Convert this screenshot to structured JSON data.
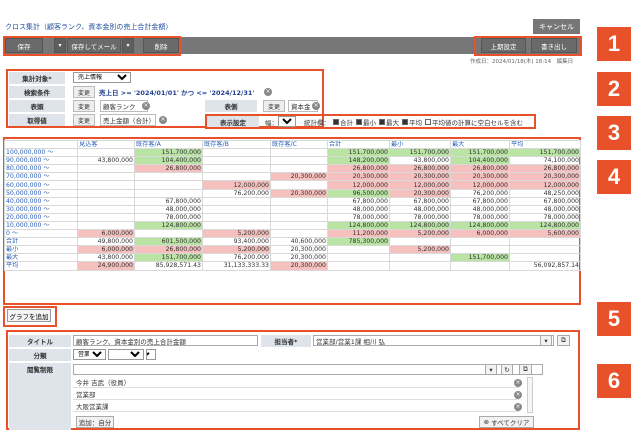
{
  "page_title": "クロス集計（顧客ランク、資本金別の売上合計金額）",
  "cancel_label": "キャンセル",
  "toolbar": {
    "save": "保存",
    "save_mail": "保存してメール",
    "delete": "削除",
    "axis_setting": "上期設定",
    "export": "書き出し"
  },
  "info_text": "作成日：2024/01/18(木) 18:14　編集日",
  "markers": [
    "1",
    "2",
    "3",
    "4",
    "5",
    "6"
  ],
  "conditions": {
    "target_label": "集計対象*",
    "target_value": "売上情報",
    "search_label": "検索条件",
    "change": "変更",
    "search_value": "売上日 >= '2024/01/01' かつ <= '2024/12/31'",
    "rows_label": "表頭",
    "rows_value": "顧客ランク",
    "cols_label": "表側",
    "cols_value": "資本金",
    "measure_label": "取得値",
    "measure_value": "売上金額（合計）",
    "display_label": "表示設定",
    "width_label": "幅：",
    "width_value": "小",
    "stats_label": "統計欄：",
    "stat_sum": "合計",
    "stat_min": "最小",
    "stat_max": "最大",
    "stat_avg": "平均",
    "blank_label": "平均値の計算に空白セルを含む"
  },
  "table": {
    "headers": [
      "",
      "見込客",
      "既存客/A",
      "既存客/B",
      "既存客/C",
      "合計",
      "最小",
      "最大",
      "平均"
    ],
    "rows": [
      [
        "100,000,000 ～",
        "",
        "151,700,000",
        "",
        "",
        "151,700,000",
        "151,700,000",
        "151,700,000",
        "151,700,000"
      ],
      [
        "90,000,000 ～",
        "43,800,000",
        "104,400,000",
        "",
        "",
        "148,200,000",
        "43,800,000",
        "104,400,000",
        "74,100,000"
      ],
      [
        "80,000,000 ～",
        "",
        "26,800,000",
        "",
        "",
        "26,800,000",
        "26,800,000",
        "26,800,000",
        "26,800,000"
      ],
      [
        "70,000,000 ～",
        "",
        "",
        "",
        "20,300,000",
        "20,300,000",
        "20,300,000",
        "20,300,000",
        "20,300,000"
      ],
      [
        "60,000,000 ～",
        "",
        "",
        "12,000,000",
        "",
        "12,000,000",
        "12,000,000",
        "12,000,000",
        "12,000,000"
      ],
      [
        "50,000,000 ～",
        "",
        "",
        "76,200,000",
        "20,300,000",
        "96,500,000",
        "20,300,000",
        "76,200,000",
        "48,250,000"
      ],
      [
        "40,000,000 ～",
        "",
        "67,800,000",
        "",
        "",
        "67,800,000",
        "67,800,000",
        "67,800,000",
        "67,800,000"
      ],
      [
        "30,000,000 ～",
        "",
        "48,000,000",
        "",
        "",
        "48,000,000",
        "48,000,000",
        "48,000,000",
        "48,000,000"
      ],
      [
        "20,000,000 ～",
        "",
        "78,000,000",
        "",
        "",
        "78,000,000",
        "78,000,000",
        "78,000,000",
        "78,000,000"
      ],
      [
        "10,000,000 ～",
        "",
        "124,800,000",
        "",
        "",
        "124,800,000",
        "124,800,000",
        "124,800,000",
        "124,800,000"
      ],
      [
        "0 ～",
        "6,000,000",
        "",
        "5,200,000",
        "",
        "11,200,000",
        "5,200,000",
        "6,000,000",
        "5,600,000"
      ],
      [
        "合計",
        "49,800,000",
        "601,500,000",
        "93,400,000",
        "40,600,000",
        "785,300,000",
        "",
        "",
        ""
      ],
      [
        "最小",
        "6,000,000",
        "26,800,000",
        "5,200,000",
        "20,300,000",
        "",
        "5,200,000",
        "",
        ""
      ],
      [
        "最大",
        "43,800,000",
        "151,700,000",
        "76,200,000",
        "20,300,000",
        "",
        "",
        "151,700,000",
        ""
      ],
      [
        "平均",
        "24,900,000",
        "85,928,571.43",
        "31,133,333.33",
        "20,300,000",
        "",
        "",
        "",
        "56,092,857.14"
      ]
    ],
    "highlights": [
      [
        "",
        "",
        "g",
        "",
        "",
        "g",
        "g",
        "g",
        "g"
      ],
      [
        "",
        "",
        "g",
        "",
        "",
        "g",
        "",
        "g",
        ""
      ],
      [
        "",
        "",
        "r",
        "",
        "",
        "r",
        "r",
        "r",
        "r"
      ],
      [
        "",
        "",
        "",
        "",
        "r",
        "r",
        "r",
        "r",
        "r"
      ],
      [
        "",
        "",
        "",
        "r",
        "",
        "r",
        "r",
        "r",
        "r"
      ],
      [
        "",
        "",
        "",
        "",
        "r",
        "g",
        "r",
        "",
        ""
      ],
      [
        "",
        "",
        "",
        "",
        "",
        "",
        "",
        "",
        ""
      ],
      [
        "",
        "",
        "",
        "",
        "",
        "",
        "",
        "",
        ""
      ],
      [
        "",
        "",
        "",
        "",
        "",
        "",
        "",
        "",
        ""
      ],
      [
        "",
        "",
        "g",
        "",
        "",
        "g",
        "g",
        "g",
        "g"
      ],
      [
        "",
        "r",
        "",
        "r",
        "",
        "r",
        "r",
        "r",
        "r"
      ],
      [
        "",
        "",
        "g",
        "",
        "",
        "g",
        "",
        "",
        ""
      ],
      [
        "",
        "r",
        "r",
        "r",
        "",
        "",
        "r",
        "",
        ""
      ],
      [
        "",
        "",
        "g",
        "",
        "",
        "",
        "",
        "g",
        ""
      ],
      [
        "",
        "r",
        "",
        "",
        "r",
        "",
        "",
        "",
        ""
      ]
    ]
  },
  "graph_button": "グラフを追加",
  "form": {
    "title_label": "タイトル",
    "title_value": "顧客ランク、資本金別の売上合計金額",
    "owner_label": "担当者*",
    "owner_value": "営業部/営業1課 相川 弘",
    "category_label": "分類",
    "category_value": "営業部",
    "browse_label": "閲覧制限",
    "browse_items": [
      "今井 吉武（役員）",
      "営業部",
      "大阪営業課"
    ],
    "add_self": "追加：自分",
    "clear_all": "すべてクリア"
  },
  "colors": {
    "accent": "#e8512a",
    "green": "#b9e4a4",
    "red": "#f5c0bd",
    "link": "#2a5fb8"
  }
}
